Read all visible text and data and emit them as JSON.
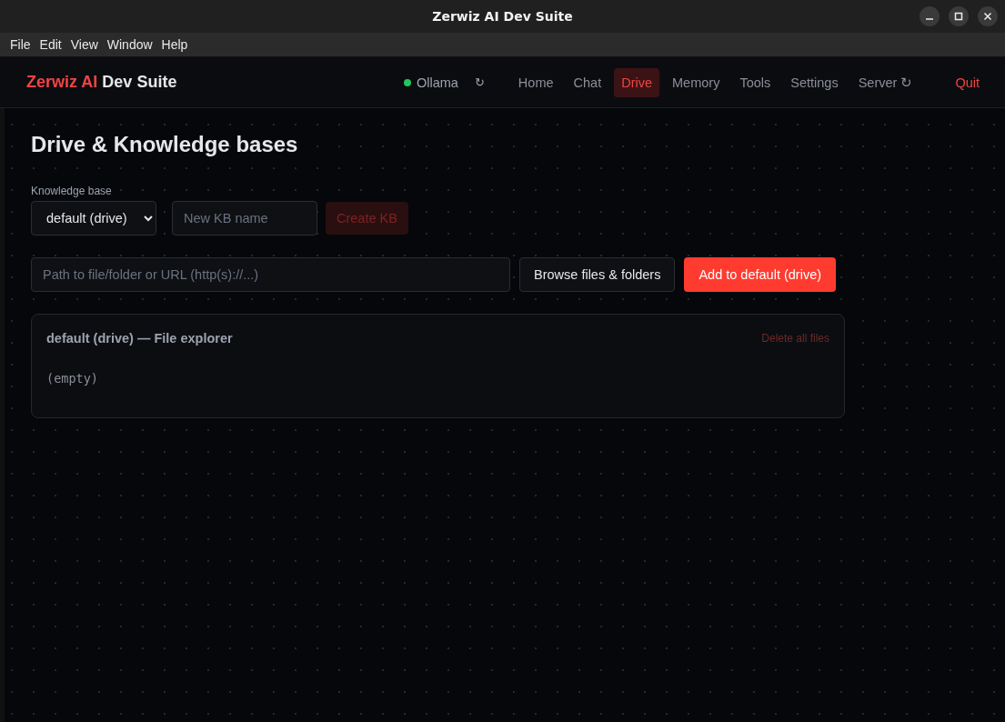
{
  "window": {
    "title": "Zerwiz AI Dev Suite"
  },
  "menu_bar": [
    "File",
    "Edit",
    "View",
    "Window",
    "Help"
  ],
  "header": {
    "brand_accent": "Zerwiz AI",
    "brand_rest": "Dev Suite",
    "status": {
      "label": "Ollama",
      "online": true,
      "refresh": "↻"
    },
    "nav": [
      {
        "label": "Home",
        "selected": false
      },
      {
        "label": "Chat",
        "selected": false
      },
      {
        "label": "Drive",
        "selected": true
      },
      {
        "label": "Memory",
        "selected": false
      },
      {
        "label": "Tools",
        "selected": false
      },
      {
        "label": "Settings",
        "selected": false
      },
      {
        "label": "Server ↻",
        "selected": false
      }
    ],
    "quit": "Quit"
  },
  "page": {
    "heading": "Drive & Knowledge bases",
    "kb_label": "Knowledge base",
    "kb_select": "default (drive)",
    "new_kb": {
      "placeholder": "New KB name"
    },
    "create_button": {
      "label": "Create KB",
      "disabled": true
    },
    "path_field": {
      "placeholder": "Path to file/folder or URL (http(s)://...)"
    },
    "browse_button": "Browse files & folders",
    "add_button": "Add to default (drive)",
    "explorer": {
      "title": "default (drive) — File explorer",
      "delete_button": {
        "label": "Delete all files",
        "disabled": true
      },
      "empty_text": "(empty)"
    }
  }
}
